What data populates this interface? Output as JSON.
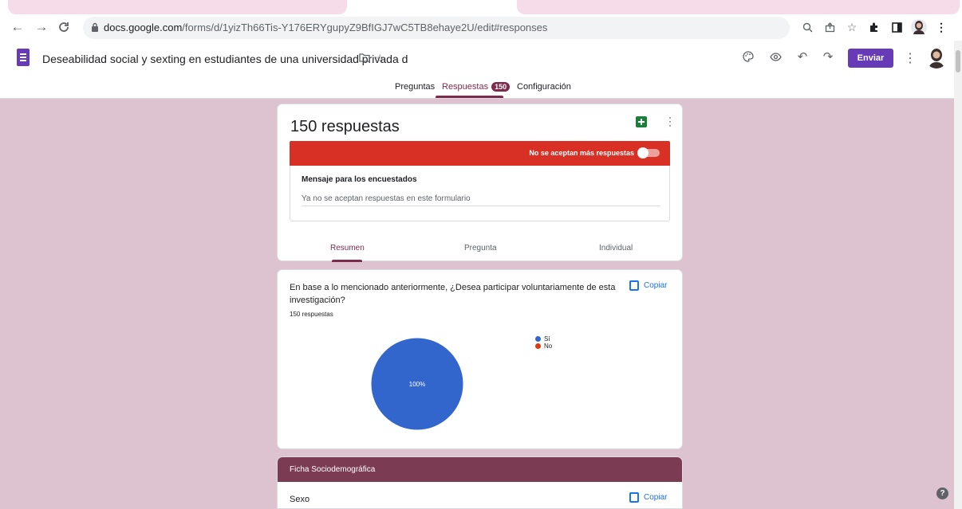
{
  "browser": {
    "url_host": "docs.google.com",
    "url_path": "/forms/d/1yizTh66Tis-Y176ERYgupyZ9BfIGJ7wC5TB8ehaye2U/edit#responses"
  },
  "form": {
    "title": "Deseabilidad social y sexting en estudiantes de una universidad privada d",
    "send_label": "Enviar",
    "tabs": [
      {
        "label": "Preguntas"
      },
      {
        "label": "Respuestas",
        "badge": "150"
      },
      {
        "label": "Configuración"
      }
    ],
    "active_tab": "Respuestas"
  },
  "summary": {
    "count_title": "150 respuestas",
    "accept_label": "No se aceptan más respuestas",
    "accepting": false,
    "message_label": "Mensaje para los encuestados",
    "message_value": "Ya no se aceptan respuestas en este formulario",
    "tabs": [
      "Resumen",
      "Pregunta",
      "Individual"
    ],
    "active_tab": "Resumen"
  },
  "question": {
    "text": "En base a lo mencionado anteriormente, ¿Desea participar voluntariamente de esta investigación?",
    "copy_label": "Copiar",
    "responses": "150 respuestas",
    "chart_data": {
      "type": "pie",
      "categories": [
        "Sí",
        "No"
      ],
      "values": [
        100,
        0
      ],
      "labels": [
        "100%",
        ""
      ],
      "colors": [
        "#3366cc",
        "#dc3912"
      ],
      "legend": "right"
    }
  },
  "section": {
    "title": "Ficha Sociodemográfica",
    "first_question": "Sexo",
    "copy_label": "Copiar"
  },
  "colors": {
    "accent": "#7b2c4d",
    "background": "#dcc3cf",
    "send": "#673ab7",
    "alert": "#d93025"
  }
}
